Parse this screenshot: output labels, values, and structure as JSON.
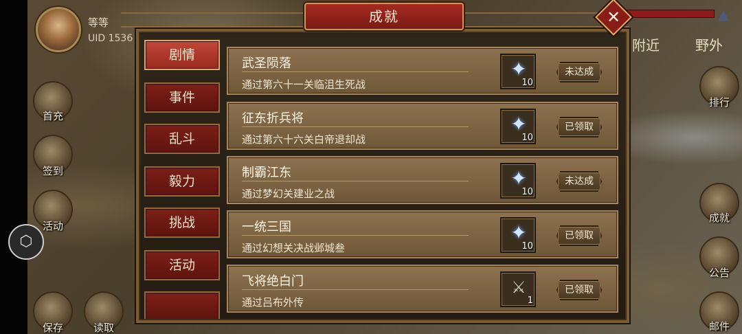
{
  "player": {
    "name": "等等",
    "uid": "UID  1536"
  },
  "top_tabs": {
    "nearby": "附近",
    "field": "野外"
  },
  "left_buttons": [
    {
      "label": "首充",
      "icon": "first-recharge-icon"
    },
    {
      "label": "签到",
      "icon": "checkin-icon"
    },
    {
      "label": "活动",
      "icon": "activity-icon"
    },
    {
      "label": "保存",
      "icon": "save-icon"
    },
    {
      "label": "读取",
      "icon": "load-icon"
    }
  ],
  "right_buttons": [
    {
      "label": "排行",
      "icon": "ranking-icon"
    },
    {
      "label": "成就",
      "icon": "achievement-icon"
    },
    {
      "label": "公告",
      "icon": "notice-icon"
    },
    {
      "label": "邮件",
      "icon": "mail-icon"
    }
  ],
  "dialog": {
    "title": "成就",
    "close_icon": "close-icon"
  },
  "categories": [
    {
      "label": "剧情",
      "active": true
    },
    {
      "label": "事件",
      "active": false
    },
    {
      "label": "乱斗",
      "active": false
    },
    {
      "label": "毅力",
      "active": false
    },
    {
      "label": "挑战",
      "active": false
    },
    {
      "label": "活动",
      "active": false
    }
  ],
  "achievements": [
    {
      "title": "武圣陨落",
      "desc": "通过第六十一关临沮生死战",
      "reward_icon": "diamond-icon",
      "reward_count": "10",
      "status": "未达成"
    },
    {
      "title": "征东折兵将",
      "desc": "通过第六十六关白帝退却战",
      "reward_icon": "diamond-icon",
      "reward_count": "10",
      "status": "已领取"
    },
    {
      "title": "制霸江东",
      "desc": "通过梦幻关建业之战",
      "reward_icon": "diamond-icon",
      "reward_count": "10",
      "status": "未达成"
    },
    {
      "title": "一统三国",
      "desc": "通过幻想关决战邺城叁",
      "reward_icon": "diamond-icon",
      "reward_count": "10",
      "status": "已领取"
    },
    {
      "title": "飞将绝白门",
      "desc": "通过吕布外传",
      "reward_icon": "sword-icon",
      "reward_count": "1",
      "status": "已领取"
    }
  ],
  "colors": {
    "title_plate": "#a52a22",
    "active_tab": "#c2473a",
    "item_bg": "#8d7250"
  }
}
